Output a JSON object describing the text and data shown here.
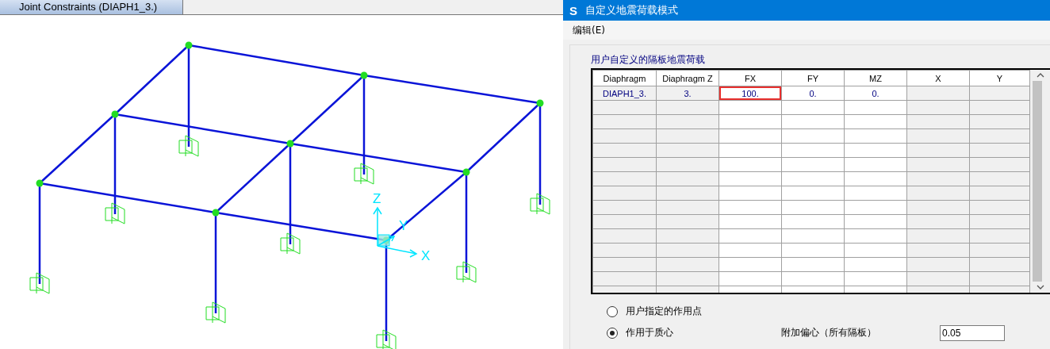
{
  "viewport": {
    "tab": {
      "label": "Joint Constraints (DIAPH1_3.)",
      "selected": true
    },
    "axes": [
      {
        "kind": "z",
        "label": "Z"
      },
      {
        "kind": "y",
        "label": "Y"
      },
      {
        "kind": "x",
        "label": "X"
      }
    ]
  },
  "dialog": {
    "title": "自定义地震荷载模式",
    "app_icon": "S",
    "menu": [
      "编辑(E)"
    ],
    "group_title": "用户自定义的隔板地震荷载",
    "table": {
      "columns": [
        {
          "label": "Diaphragm",
          "editable": false
        },
        {
          "label": "Diaphragm Z",
          "editable": false
        },
        {
          "label": "FX",
          "editable": true
        },
        {
          "label": "FY",
          "editable": true
        },
        {
          "label": "MZ",
          "editable": true
        },
        {
          "label": "X",
          "editable": false
        },
        {
          "label": "Y",
          "editable": false
        }
      ],
      "rows": [
        {
          "cells": [
            {
              "text": "DIAPH1_3.",
              "selected": false
            },
            {
              "text": "3.",
              "selected": false
            },
            {
              "text": "100.",
              "selected": true
            },
            {
              "text": "0.",
              "selected": false
            },
            {
              "text": "0.",
              "selected": false
            },
            {
              "text": "",
              "selected": false
            },
            {
              "text": "",
              "selected": false
            }
          ]
        }
      ]
    },
    "options": [
      {
        "label": "用户指定的作用点",
        "selected": false
      },
      {
        "label": "作用于质心",
        "selected": true
      }
    ],
    "eccentricity": {
      "label": "附加偏心（所有隔板）",
      "value": "0.05"
    }
  }
}
